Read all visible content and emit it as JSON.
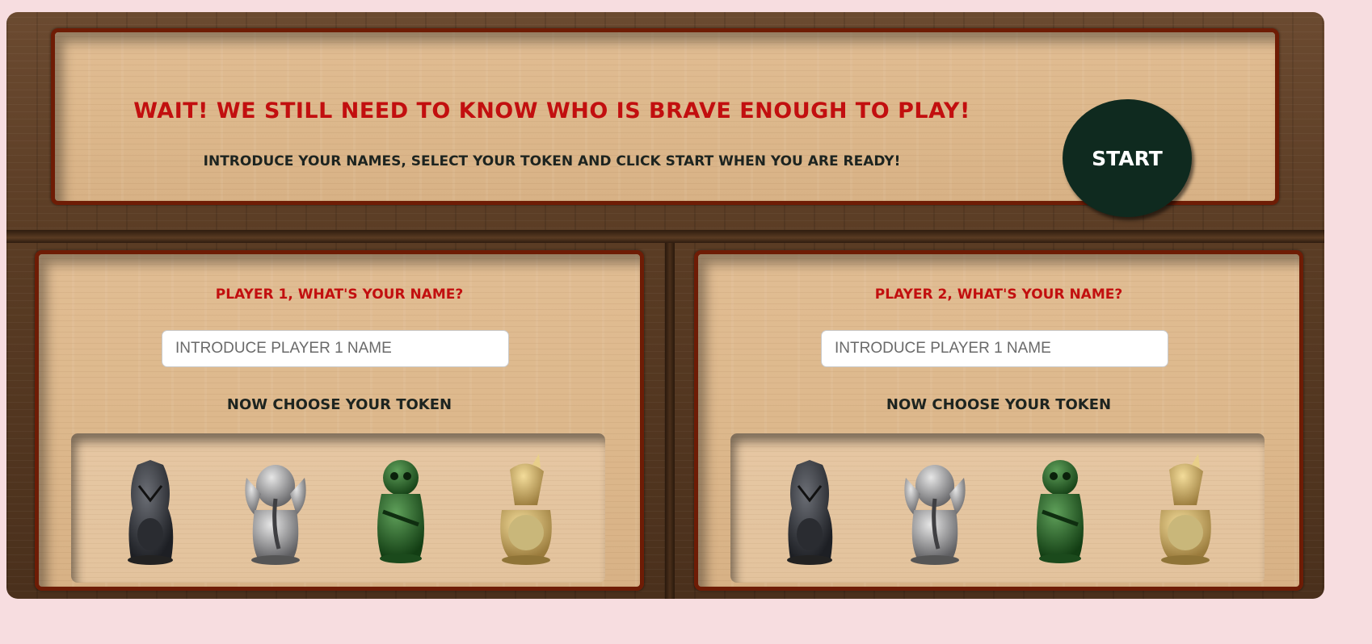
{
  "header": {
    "headline": "WAIT! WE STILL NEED TO KNOW WHO IS BRAVE ENOUGH TO PLAY!",
    "instructions": "INTRODUCE YOUR NAMES, SELECT YOUR TOKEN AND CLICK START WHEN YOU ARE READY!",
    "start_label": "START"
  },
  "players": [
    {
      "title": "PLAYER 1, WHAT'S YOUR NAME?",
      "name_placeholder": "INTRODUCE PLAYER 1 NAME",
      "token_label": "NOW CHOOSE YOUR TOKEN",
      "tokens": [
        "black-gorilla-token",
        "silver-elephant-token",
        "green-monkey-token",
        "gold-rhino-token"
      ]
    },
    {
      "title": "PLAYER 2, WHAT'S YOUR NAME?",
      "name_placeholder": "INTRODUCE PLAYER 1 NAME",
      "token_label": "NOW CHOOSE YOUR TOKEN",
      "tokens": [
        "black-gorilla-token",
        "silver-elephant-token",
        "green-monkey-token",
        "gold-rhino-token"
      ]
    }
  ],
  "colors": {
    "page_background": "#f7dde0",
    "headline_red": "#c20f0f",
    "panel_border": "#6e1c05",
    "start_button": "#0f2a1f"
  }
}
